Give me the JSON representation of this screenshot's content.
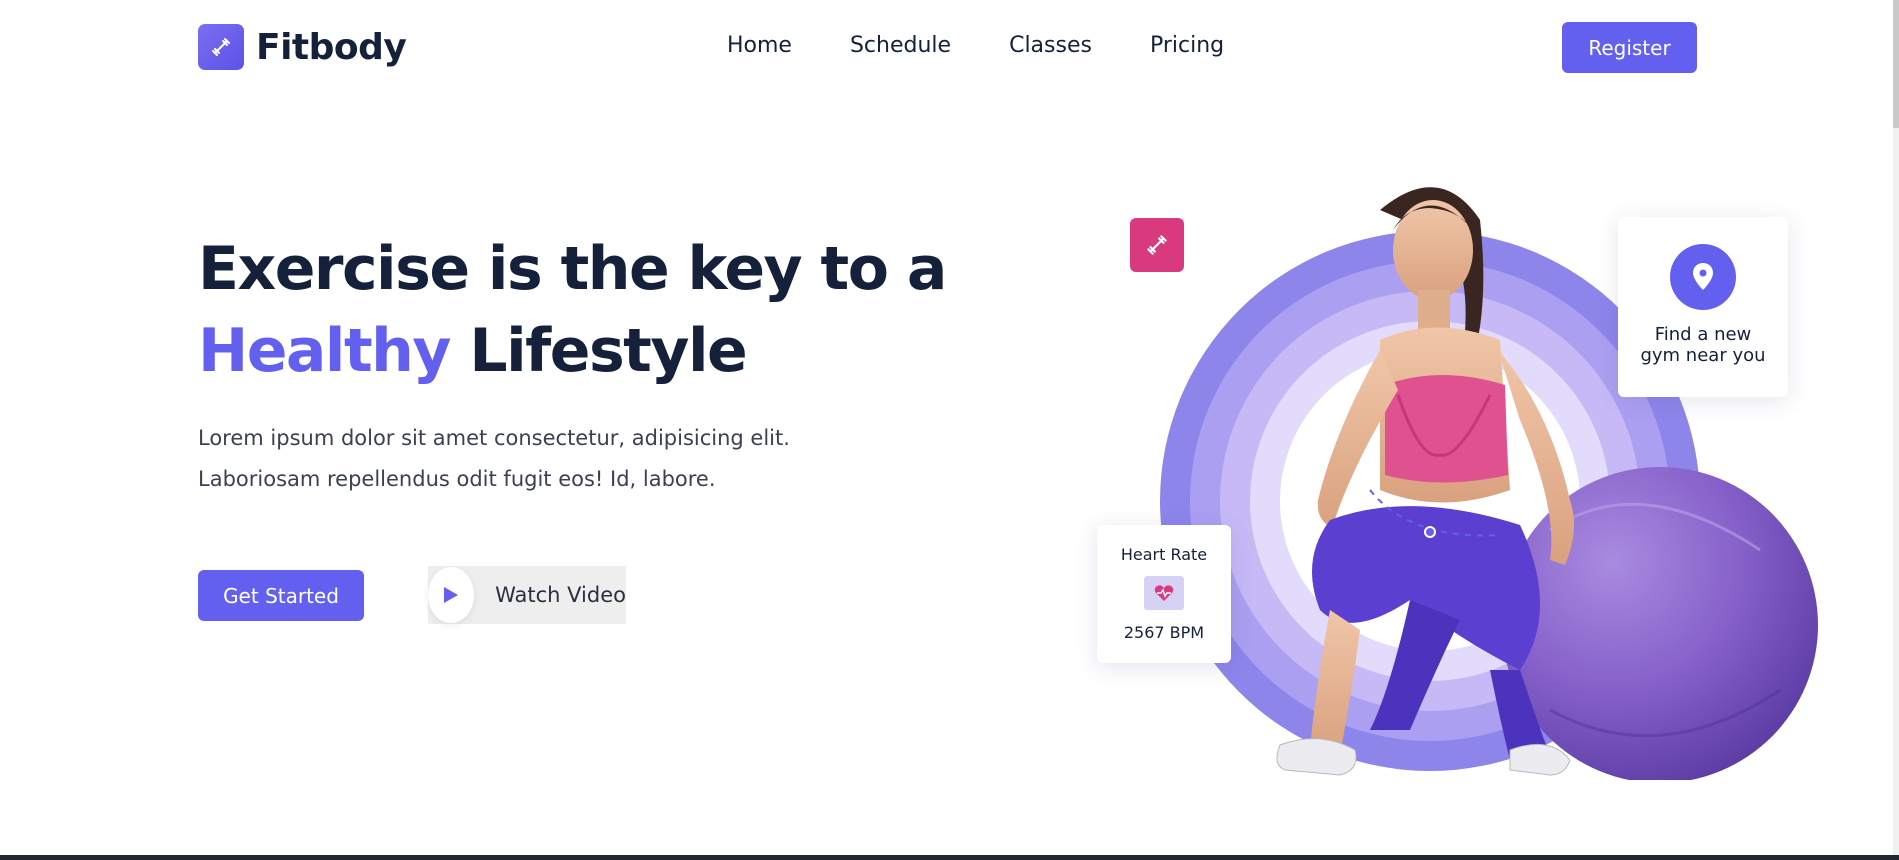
{
  "brand": {
    "name": "Fitbody",
    "icon": "dumbbell-icon"
  },
  "nav": {
    "items": [
      "Home",
      "Schedule",
      "Classes",
      "Pricing"
    ]
  },
  "header": {
    "register_label": "Register"
  },
  "hero": {
    "title_line1": "Exercise is the key to a",
    "title_accent": "Healthy",
    "title_rest": " Lifestyle",
    "description_line1": "Lorem ipsum dolor sit amet consectetur, adipisicing elit.",
    "description_line2": "Laboriosam repellendus odit fugit eos! Id, labore.",
    "cta_label": "Get Started",
    "video_label": "Watch Video"
  },
  "cards": {
    "gym_line1": "Find a new",
    "gym_line2": "gym near you",
    "heart_title": "Heart Rate",
    "heart_value": "2567 BPM"
  },
  "colors": {
    "accent": "#6360ef",
    "pink": "#d93a7e",
    "text": "#15213b"
  }
}
